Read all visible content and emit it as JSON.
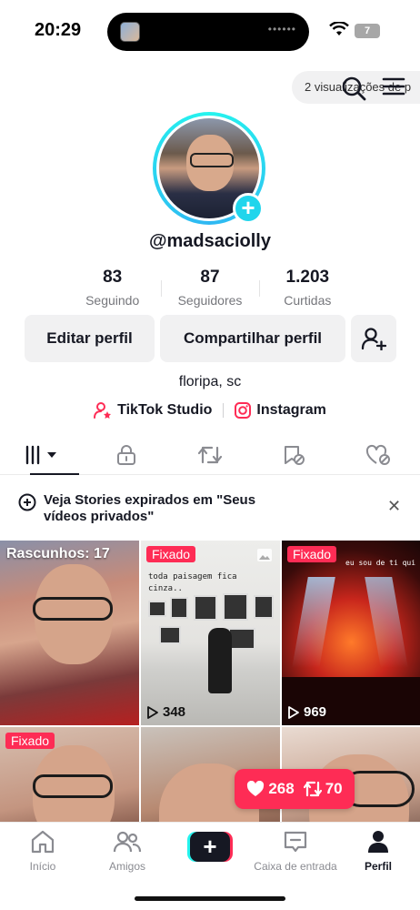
{
  "status_bar": {
    "time": "20:29",
    "battery": "7"
  },
  "header": {
    "views_pill": "2 visualizações de p"
  },
  "profile": {
    "username": "@madsaciolly",
    "stats": [
      {
        "value": "83",
        "label": "Seguindo"
      },
      {
        "value": "87",
        "label": "Seguidores"
      },
      {
        "value": "1.203",
        "label": "Curtidas"
      }
    ],
    "buttons": {
      "edit": "Editar perfil",
      "share": "Compartilhar perfil"
    },
    "bio": "floripa, sc",
    "links": {
      "studio": "TikTok Studio",
      "instagram": "Instagram"
    }
  },
  "tabs": [
    "videos",
    "private",
    "reposts",
    "favorites",
    "liked"
  ],
  "banner": {
    "text": "Veja Stories expirados em \"Seus vídeos privados\""
  },
  "grid": {
    "drafts_label": "Rascunhos: 17",
    "pinned_label": "Fixado",
    "items": [
      {
        "views": ""
      },
      {
        "views": "348",
        "caption": "toda paisagem fica cinza.."
      },
      {
        "views": "969",
        "caption": "eu sou de ti qui"
      }
    ]
  },
  "like_popup": {
    "likes": "268",
    "reposts": "70"
  },
  "bottom_nav": {
    "home": "Início",
    "friends": "Amigos",
    "inbox": "Caixa de entrada",
    "profile": "Perfil"
  },
  "colors": {
    "accent": "#fe2c55",
    "cyan": "#25f4ee",
    "text": "#161823"
  }
}
